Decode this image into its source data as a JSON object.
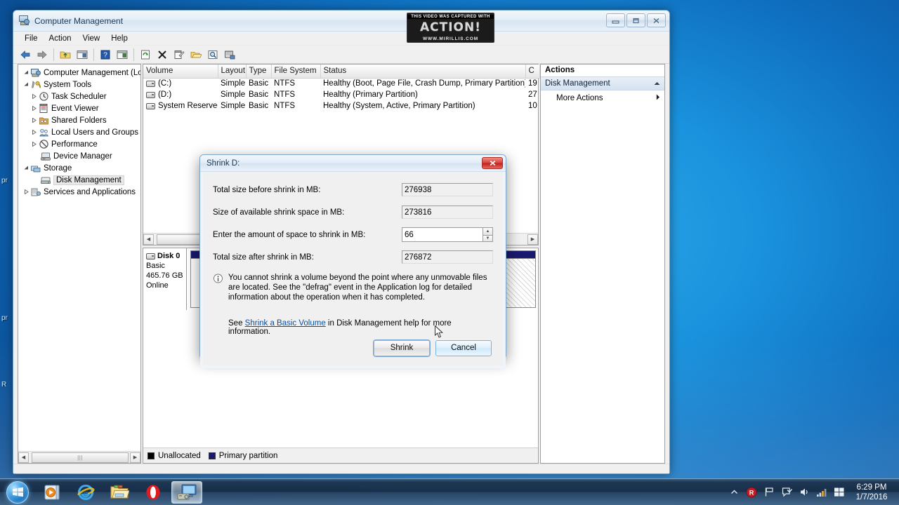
{
  "desktop": {
    "labels": [
      "pr",
      "pr",
      "R"
    ]
  },
  "window": {
    "title": "Computer Management",
    "icon": "computer-management-icon",
    "watermark": {
      "line1": "THIS VIDEO WAS CAPTURED WITH",
      "line2": "ACTION!",
      "line3": "WWW.MIRILLIS.COM"
    },
    "caption_buttons": [
      "minimize",
      "maximize",
      "close"
    ],
    "menus": [
      "File",
      "Action",
      "View",
      "Help"
    ],
    "toolbar_icons": [
      "back-arrow-icon",
      "forward-arrow-icon",
      "separator",
      "up-folder-icon",
      "show-hide-console-tree-icon",
      "separator",
      "help-icon",
      "show-hide-action-pane-icon",
      "separator",
      "refresh-icon",
      "delete-icon",
      "properties-icon",
      "open-folder-icon",
      "find-icon",
      "rescan-disks-icon"
    ]
  },
  "tree": {
    "root": "Computer Management (Local",
    "items": [
      {
        "label": "System Tools",
        "depth": 1,
        "expander": "expanded",
        "icon": "system-tools-icon",
        "selected": false
      },
      {
        "label": "Task Scheduler",
        "depth": 2,
        "expander": "collapsed",
        "icon": "clock-icon",
        "selected": false
      },
      {
        "label": "Event Viewer",
        "depth": 2,
        "expander": "collapsed",
        "icon": "event-viewer-icon",
        "selected": false
      },
      {
        "label": "Shared Folders",
        "depth": 2,
        "expander": "collapsed",
        "icon": "shared-folders-icon",
        "selected": false
      },
      {
        "label": "Local Users and Groups",
        "depth": 2,
        "expander": "collapsed",
        "icon": "users-icon",
        "selected": false
      },
      {
        "label": "Performance",
        "depth": 2,
        "expander": "collapsed",
        "icon": "performance-icon",
        "selected": false
      },
      {
        "label": "Device Manager",
        "depth": 2,
        "expander": "none",
        "icon": "device-manager-icon",
        "selected": false
      },
      {
        "label": "Storage",
        "depth": 1,
        "expander": "expanded",
        "icon": "storage-icon",
        "selected": false
      },
      {
        "label": "Disk Management",
        "depth": 2,
        "expander": "none",
        "icon": "disk-management-icon",
        "selected": true
      },
      {
        "label": "Services and Applications",
        "depth": 1,
        "expander": "collapsed",
        "icon": "services-icon",
        "selected": false
      }
    ]
  },
  "volume_list": {
    "columns": [
      "Volume",
      "Layout",
      "Type",
      "File System",
      "Status",
      "C"
    ],
    "rows": [
      {
        "volume": "(C:)",
        "layout": "Simple",
        "type": "Basic",
        "filesystem": "NTFS",
        "status": "Healthy (Boot, Page File, Crash Dump, Primary Partition)",
        "capacity": "19"
      },
      {
        "volume": "(D:)",
        "layout": "Simple",
        "type": "Basic",
        "filesystem": "NTFS",
        "status": "Healthy (Primary Partition)",
        "capacity": "27"
      },
      {
        "volume": "System Reserved",
        "layout": "Simple",
        "type": "Basic",
        "filesystem": "NTFS",
        "status": "Healthy (System, Active, Primary Partition)",
        "capacity": "10"
      }
    ]
  },
  "disk_graph": {
    "disk": {
      "name": "Disk 0",
      "type": "Basic",
      "size": "465.76 GB",
      "state": "Online"
    }
  },
  "legend": {
    "items": [
      {
        "label": "Unallocated",
        "color": "#000000"
      },
      {
        "label": "Primary partition",
        "color": "#191970"
      }
    ]
  },
  "actions": {
    "title": "Actions",
    "group": "Disk Management",
    "group_chevron": "chevron-up-icon",
    "items": [
      {
        "label": "More Actions",
        "chevron": "chevron-right-icon"
      }
    ]
  },
  "dialog": {
    "title": "Shrink D:",
    "close_label": "x",
    "fields": [
      {
        "label": "Total size before shrink in MB:",
        "value": "276938",
        "readonly": true
      },
      {
        "label": "Size of available shrink space in MB:",
        "value": "273816",
        "readonly": true
      },
      {
        "label": "Enter the amount of space to shrink in MB:",
        "value": "66",
        "readonly": false
      },
      {
        "label": "Total size after shrink in MB:",
        "value": "276872",
        "readonly": true
      }
    ],
    "info_icon": "info-icon",
    "info_text": "You cannot shrink a volume beyond the point where any unmovable files are located. See the \"defrag\" event in the Application log for detailed information about the operation when it has completed.",
    "help_prefix": "See ",
    "help_link": "Shrink a Basic Volume",
    "help_suffix": " in Disk Management help for more information.",
    "buttons": {
      "shrink": "Shrink",
      "cancel": "Cancel"
    }
  },
  "taskbar": {
    "start": "start-orb-icon",
    "buttons": [
      {
        "name": "windows-media-player",
        "icon": "media-player-icon",
        "active": false
      },
      {
        "name": "internet-explorer",
        "icon": "internet-explorer-icon",
        "active": false
      },
      {
        "name": "windows-explorer",
        "icon": "folder-icon",
        "active": false
      },
      {
        "name": "opera-browser",
        "icon": "opera-icon",
        "active": false
      },
      {
        "name": "computer-management",
        "icon": "computer-management-icon",
        "active": true
      }
    ],
    "tray": [
      "show-hidden-icons-icon",
      "action-recorder-icon",
      "network-flag-icon",
      "action-center-icon",
      "volume-icon",
      "signal-icon",
      "windows-flag-icon"
    ],
    "clock": {
      "time": "6:29 PM",
      "date": "1/7/2016"
    }
  }
}
